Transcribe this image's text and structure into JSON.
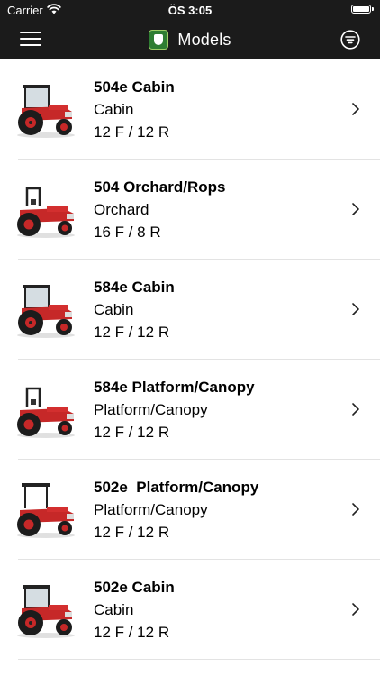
{
  "status_bar": {
    "carrier": "Carrier",
    "time": "ÖS 3:05",
    "wifi_icon": "wifi-icon",
    "battery_icon": "battery-icon"
  },
  "nav": {
    "title": "Models",
    "menu_icon": "hamburger-menu-icon",
    "logo_icon": "brand-logo-icon",
    "filter_icon": "filter-icon",
    "bar_color": "#1b1b1b"
  },
  "models": [
    {
      "name": "504e Cabin",
      "type": "Cabin",
      "gears": "12 F / 12 R",
      "variant": "cabin"
    },
    {
      "name": "504 Orchard/Rops",
      "type": "Orchard",
      "gears": "16 F / 8 R",
      "variant": "rops"
    },
    {
      "name": "584e Cabin",
      "type": "Cabin",
      "gears": "12 F / 12 R",
      "variant": "cabin"
    },
    {
      "name": "584e Platform/Canopy",
      "type": "Platform/Canopy",
      "gears": "12 F / 12 R",
      "variant": "rops"
    },
    {
      "name": "502e  Platform/Canopy",
      "type": "Platform/Canopy",
      "gears": "12 F / 12 R",
      "variant": "canopy"
    },
    {
      "name": "502e Cabin",
      "type": "Cabin",
      "gears": "12 F / 12 R",
      "variant": "cabin"
    }
  ],
  "accent_color": "#c62828"
}
